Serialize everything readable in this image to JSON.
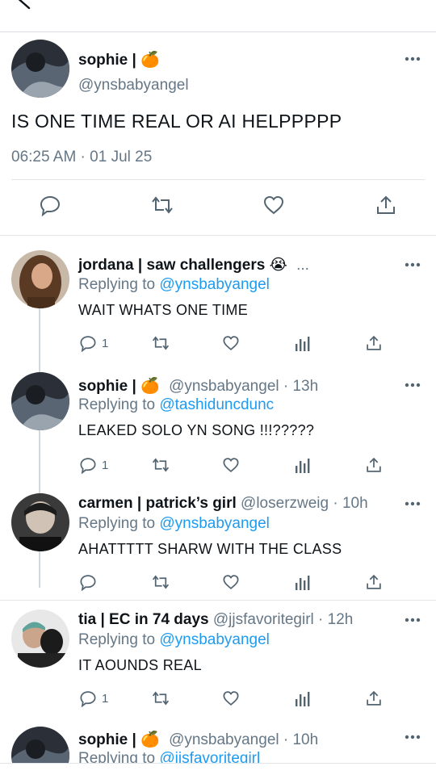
{
  "header": {
    "back_icon": "arrow-left-icon"
  },
  "main_tweet": {
    "name": "sophie |",
    "name_emoji": "🍊",
    "handle": "@ynsbabyangel",
    "text": "IS ONE TIME REAL OR AI HELPPPPP",
    "timestamp": "06:25 AM · 01 Jul 25",
    "actions": [
      "reply-icon",
      "retweet-icon",
      "like-icon",
      "share-icon"
    ]
  },
  "replies": [
    {
      "name": "jordana | saw challengers",
      "name_emoji": "😭",
      "handle": "...",
      "time": "",
      "replying_label": "Replying to",
      "replying_to": "@ynsbabyangel",
      "text": "WAIT WHATS ONE TIME",
      "reply_count": "1"
    },
    {
      "name": "sophie |",
      "name_emoji": "🍊",
      "handle": "@ynsbabyangel · 13h",
      "time": "",
      "replying_label": "Replying to",
      "replying_to": "@tashiduncdunc",
      "text": "LEAKED SOLO YN SONG !!!?????",
      "reply_count": "1"
    },
    {
      "name": "carmen | patrick’s girl",
      "name_emoji": "",
      "handle": "@loserzweig · 10h",
      "time": "",
      "replying_label": "Replying to",
      "replying_to": "@ynsbabyangel",
      "text": "AHATTTTT SHARW WITH THE CLASS",
      "reply_count": ""
    },
    {
      "name": "tia | EC in 74 days",
      "name_emoji": "",
      "handle": "@jjsfavoritegirl · 12h",
      "time": "",
      "replying_label": "Replying to",
      "replying_to": "@ynsbabyangel",
      "text": "IT AOUNDS REAL",
      "reply_count": "1"
    },
    {
      "name": "sophie |",
      "name_emoji": "🍊",
      "handle": "@ynsbabyangel · 10h",
      "time": "",
      "replying_label": "Replying to",
      "replying_to": "@jjsfavoritegirl",
      "text": "",
      "reply_count": ""
    }
  ],
  "colors": {
    "link": "#1d9bf0",
    "secondary": "#657786",
    "icon": "#536471",
    "divider": "#e3e6e9"
  }
}
